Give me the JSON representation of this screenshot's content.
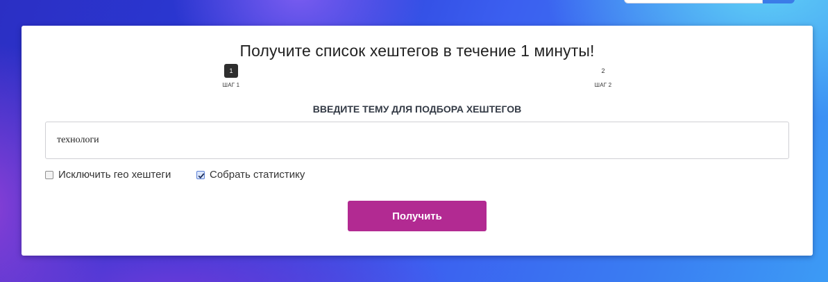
{
  "page": {
    "title": "Получите список хештегов в течение 1 минуты!"
  },
  "steps": [
    {
      "number": "1",
      "label": "ШАГ 1",
      "active": true
    },
    {
      "number": "2",
      "label": "ШАГ 2",
      "active": false
    }
  ],
  "form": {
    "topic_heading": "ВВЕДИТЕ ТЕМУ ДЛЯ ПОДБОРА ХЕШТЕГОВ",
    "topic_value": "технологи",
    "exclude_geo_label": "Исключить гео хештеги",
    "exclude_geo_checked": false,
    "collect_stats_label": "Собрать статистику",
    "collect_stats_checked": true,
    "submit_label": "Получить"
  },
  "colors": {
    "accent_button": "#b22a92",
    "active_step": "#2e2e2e",
    "background_top_right": "#5fd0f6",
    "background_main": "#2a3ad6"
  },
  "icons": {
    "cursor": "mouse-pointer-icon",
    "checkmark": "checkmark-icon"
  }
}
